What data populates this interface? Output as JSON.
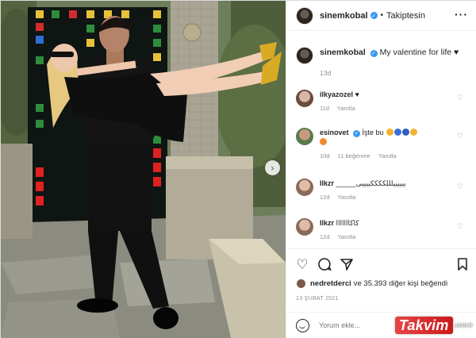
{
  "header": {
    "username": "sinemkobal",
    "separator": "•",
    "follow_status": "Takiptesin",
    "more_icon": "more-horizontal-icon"
  },
  "caption": {
    "username": "sinemkobal",
    "text": "My valentine for life ♥",
    "time": "13d"
  },
  "comments": [
    {
      "username": "ilkyazozel",
      "text": "♥",
      "time": "11d",
      "reply": "Yanıtla",
      "likes": ""
    },
    {
      "username": "esinovet",
      "text": "İşte bu",
      "time": "10d",
      "likes": "11 beğenme",
      "reply": "Yanıtla"
    },
    {
      "username": "Ilkzr",
      "text": "_____بیییییلللککککییییی",
      "time": "12d",
      "reply": "Yanıtla",
      "likes": ""
    },
    {
      "username": "Ilkzr",
      "text": "كاكااااااا",
      "time": "12d",
      "reply": "Yanıtla",
      "likes": ""
    }
  ],
  "likes": {
    "first_liker": "nedretderci",
    "text": "ve 35.393 diğer kişi beğendi"
  },
  "date": "13 ŞUBAT 2021",
  "comment_input": {
    "placeholder": "Yorum ekle..."
  },
  "watermark": {
    "text": "Takvim",
    "suffix": ".com.tr"
  },
  "colors": {
    "verified": "#3897f0",
    "brand_red": "#d42a2a"
  },
  "icons": {
    "like": "heart-icon",
    "comment": "comment-icon",
    "share": "share-icon",
    "save": "bookmark-icon",
    "emoji": "smile-icon",
    "next": "chevron-right-icon"
  }
}
